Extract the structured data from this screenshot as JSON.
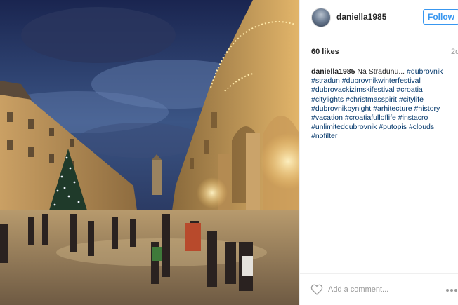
{
  "post": {
    "username": "daniella1985",
    "follow_label": "Follow",
    "likes": "60 likes",
    "timestamp": "2d",
    "caption_author": "daniella1985",
    "caption_text": "Na Stradunu...",
    "hashtags": [
      "#dubrovnik",
      "#stradun",
      "#dubrovnikwinterfestival",
      "#dubrovackizimskifestival",
      "#croatia",
      "#citylights",
      "#christmasspirit",
      "#citylife",
      "#dubrovnikbynight",
      "#arhitecture",
      "#history",
      "#vacation",
      "#croatiafulloflife",
      "#instacro",
      "#unlimiteddubrovnik",
      "#putopis",
      "#clouds",
      "#nofilter"
    ],
    "comment_placeholder": "Add a comment...",
    "icons": {
      "like": "heart-outline-icon",
      "more": "more-options-icon"
    }
  },
  "colors": {
    "accent": "#3897f0",
    "hashtag": "#003569",
    "muted": "#999999",
    "text": "#262626"
  }
}
